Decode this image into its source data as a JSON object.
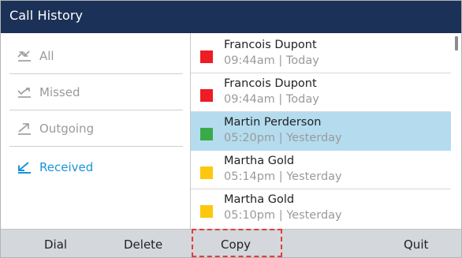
{
  "header": {
    "title": "Call History"
  },
  "filters": [
    {
      "label": "All",
      "icon": "all-calls-icon",
      "active": false
    },
    {
      "label": "Missed",
      "icon": "missed-calls-icon",
      "active": false
    },
    {
      "label": "Outgoing",
      "icon": "outgoing-calls-icon",
      "active": false
    },
    {
      "label": "Received",
      "icon": "received-calls-icon",
      "active": true
    }
  ],
  "calls": [
    {
      "name": "Francois Dupont",
      "when": "09:44am | Today",
      "status_color": "#ee1c24",
      "selected": false
    },
    {
      "name": "Francois Dupont",
      "when": "09:44am | Today",
      "status_color": "#ee1c24",
      "selected": false
    },
    {
      "name": "Martin Perderson",
      "when": "05:20pm | Yesterday",
      "status_color": "#3aaa49",
      "selected": true
    },
    {
      "name": "Martha Gold",
      "when": "05:14pm | Yesterday",
      "status_color": "#fdc70f",
      "selected": false
    },
    {
      "name": "Martha Gold",
      "when": "05:10pm | Yesterday",
      "status_color": "#fdc70f",
      "selected": false
    }
  ],
  "softkeys": {
    "dial": "Dial",
    "delete": "Delete",
    "copy": "Copy",
    "quit": "Quit"
  },
  "colors": {
    "header_bg": "#1b3157",
    "active_filter": "#1a94d8",
    "inactive_filter": "#9a9a9a",
    "selected_row": "#b4dcee",
    "softkey_bar": "#d4d7db",
    "callout_dash": "#e53c3c"
  }
}
